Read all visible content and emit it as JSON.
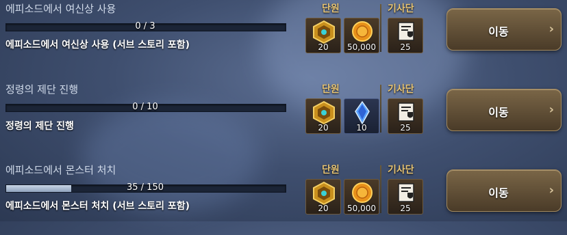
{
  "headers": {
    "group": "단원",
    "knight": "기사단"
  },
  "move_label": "이동",
  "quests": [
    {
      "title": "에피소드에서 여신상 사용",
      "progress": {
        "current": 0,
        "total": 3,
        "text": "0 / 3",
        "fraction": 0
      },
      "description": "에피소드에서 여신상 사용 (서브 스토리 포함)",
      "rewards": [
        {
          "icon": "gold-emblem-icon",
          "count": "20"
        },
        {
          "icon": "gold-coin-icon",
          "count": "50,000"
        }
      ],
      "knight_reward": {
        "icon": "knight-banner-icon",
        "count": "25"
      }
    },
    {
      "title": "정령의 제단 진행",
      "progress": {
        "current": 0,
        "total": 10,
        "text": "0 / 10",
        "fraction": 0
      },
      "description": "정령의 제단 진행",
      "rewards": [
        {
          "icon": "gold-emblem-icon",
          "count": "20"
        },
        {
          "icon": "blue-crystal-icon",
          "count": "10"
        }
      ],
      "knight_reward": {
        "icon": "knight-banner-icon",
        "count": "25"
      }
    },
    {
      "title": "에피소드에서 몬스터 처치",
      "progress": {
        "current": 35,
        "total": 150,
        "text": "35 / 150",
        "fraction": 0.233
      },
      "description": "에피소드에서 몬스터 처치 (서브 스토리 포함)",
      "rewards": [
        {
          "icon": "gold-emblem-icon",
          "count": "20"
        },
        {
          "icon": "gold-coin-icon",
          "count": "50,000"
        }
      ],
      "knight_reward": {
        "icon": "knight-banner-icon",
        "count": "25"
      }
    }
  ]
}
